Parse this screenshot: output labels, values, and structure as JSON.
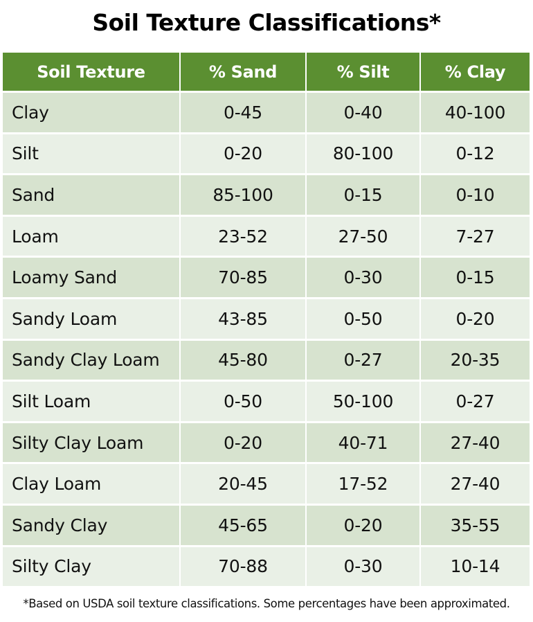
{
  "title": "Soil Texture Classifications*",
  "table": {
    "headers": [
      "Soil Texture",
      "% Sand",
      "% Silt",
      "% Clay"
    ],
    "rows": [
      {
        "texture": "Clay",
        "sand": "0-45",
        "silt": "0-40",
        "clay": "40-100"
      },
      {
        "texture": "Silt",
        "sand": "0-20",
        "silt": "80-100",
        "clay": "0-12"
      },
      {
        "texture": "Sand",
        "sand": "85-100",
        "silt": "0-15",
        "clay": "0-10"
      },
      {
        "texture": "Loam",
        "sand": "23-52",
        "silt": "27-50",
        "clay": "7-27"
      },
      {
        "texture": "Loamy Sand",
        "sand": "70-85",
        "silt": "0-30",
        "clay": "0-15"
      },
      {
        "texture": "Sandy Loam",
        "sand": "43-85",
        "silt": "0-50",
        "clay": "0-20"
      },
      {
        "texture": "Sandy Clay Loam",
        "sand": "45-80",
        "silt": "0-27",
        "clay": "20-35"
      },
      {
        "texture": "Silt Loam",
        "sand": "0-50",
        "silt": "50-100",
        "clay": "0-27"
      },
      {
        "texture": "Silty Clay Loam",
        "sand": "0-20",
        "silt": "40-71",
        "clay": "27-40"
      },
      {
        "texture": "Clay Loam",
        "sand": "20-45",
        "silt": "17-52",
        "clay": "27-40"
      },
      {
        "texture": "Sandy Clay",
        "sand": "45-65",
        "silt": "0-20",
        "clay": "35-55"
      },
      {
        "texture": "Silty Clay",
        "sand": "70-88",
        "silt": "0-30",
        "clay": "10-14"
      }
    ]
  },
  "footnote": "*Based on USDA soil texture classifications. Some percentages have been approximated.",
  "colors": {
    "header_bg": "#5b8f31",
    "row_odd_bg": "#d7e3cf",
    "row_even_bg": "#e9f0e6"
  }
}
